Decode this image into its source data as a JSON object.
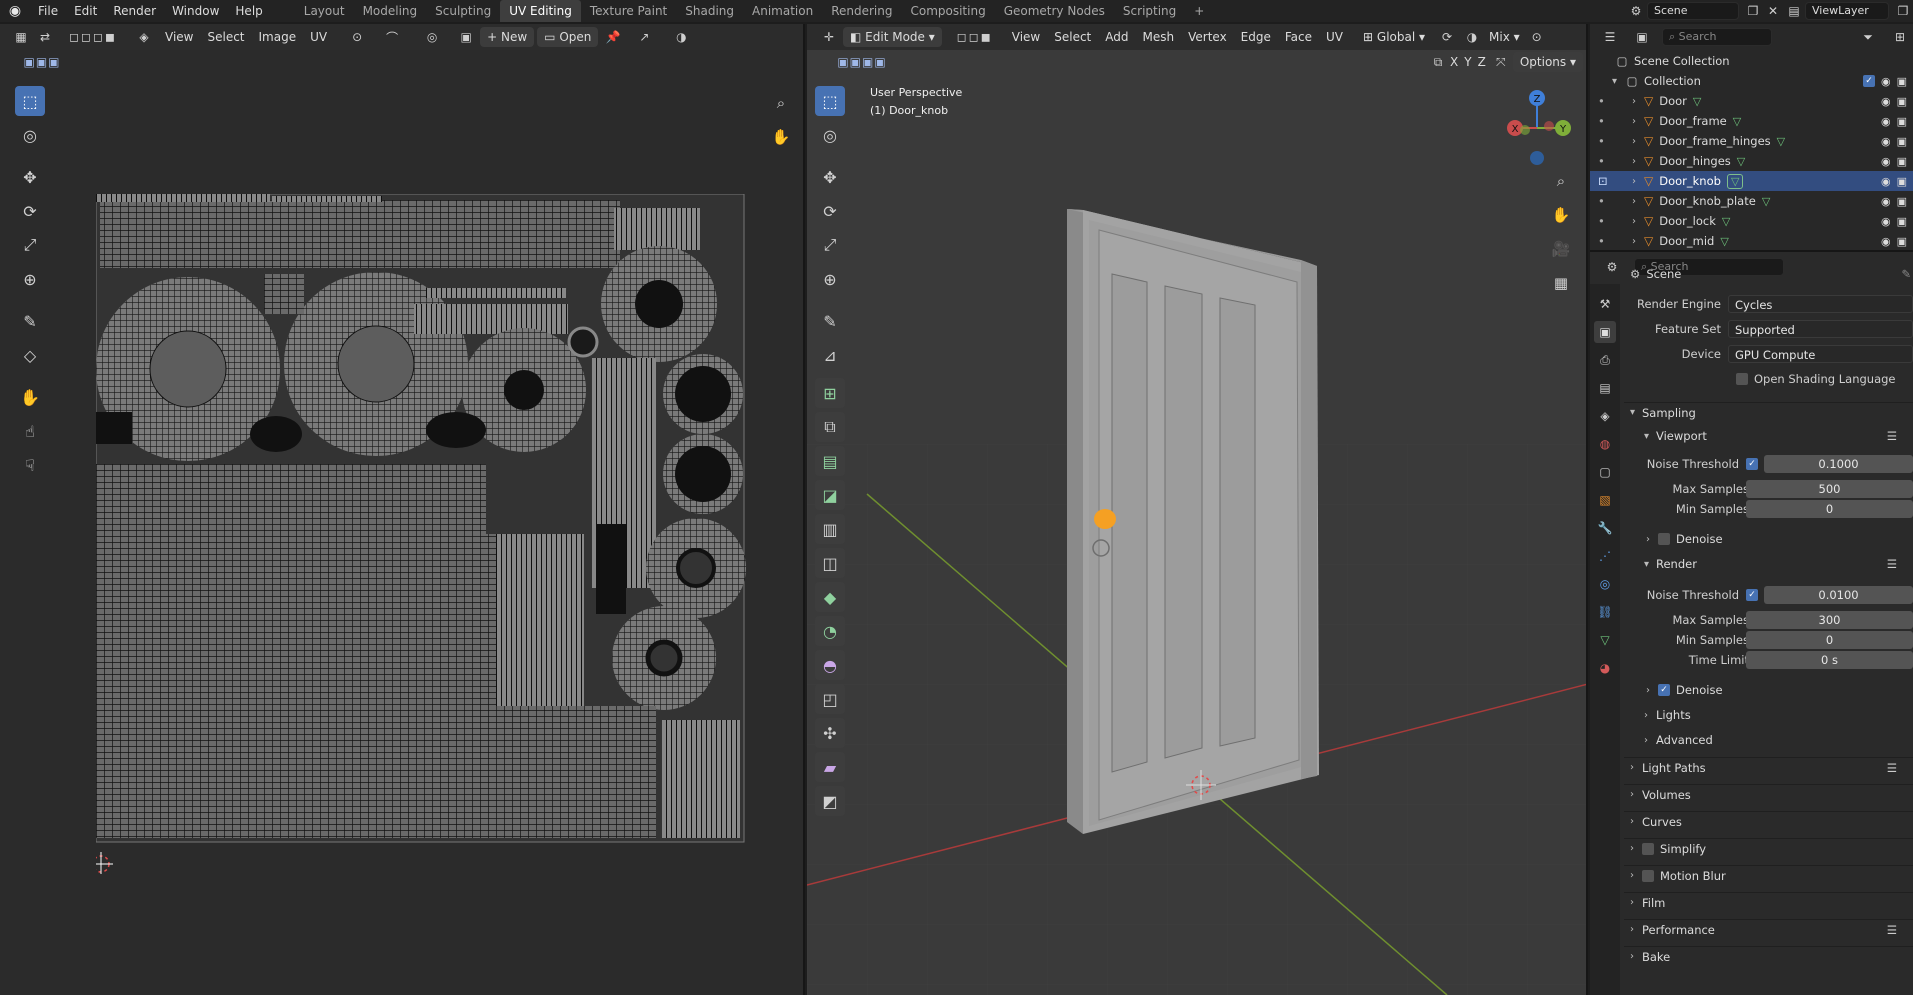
{
  "app": {
    "logo": "blender-logo-icon"
  },
  "menu": [
    "File",
    "Edit",
    "Render",
    "Window",
    "Help"
  ],
  "workspaces": [
    "Layout",
    "Modeling",
    "Sculpting",
    "UV Editing",
    "Texture Paint",
    "Shading",
    "Animation",
    "Rendering",
    "Compositing",
    "Geometry Nodes",
    "Scripting"
  ],
  "workspace_add": "+",
  "top_right": {
    "scene_label": "Scene",
    "viewlayer_label": "ViewLayer"
  },
  "uv_editor": {
    "menus": [
      "View",
      "Select",
      "Image",
      "UV"
    ],
    "new_label": "New",
    "open_label": "Open"
  },
  "viewport": {
    "mode_label": "Edit Mode",
    "menus": [
      "View",
      "Select",
      "Add",
      "Mesh",
      "Vertex",
      "Edge",
      "Face",
      "UV"
    ],
    "transform_orientation": "Global",
    "shading_mix": "Mix",
    "axis_x": "X",
    "axis_y": "Y",
    "axis_z": "Z",
    "options_label": "Options",
    "overlay_title": "User Perspective",
    "overlay_object": "(1) Door_knob",
    "gizmo": {
      "x": "X",
      "y": "Y",
      "z": "Z"
    }
  },
  "outliner": {
    "search_placeholder": "Search",
    "scene_collection": "Scene Collection",
    "collection": "Collection",
    "objects": [
      {
        "name": "Door",
        "selected": false
      },
      {
        "name": "Door_frame",
        "selected": false
      },
      {
        "name": "Door_frame_hinges",
        "selected": false
      },
      {
        "name": "Door_hinges",
        "selected": false
      },
      {
        "name": "Door_knob",
        "selected": true
      },
      {
        "name": "Door_knob_plate",
        "selected": false
      },
      {
        "name": "Door_lock",
        "selected": false
      },
      {
        "name": "Door_mid",
        "selected": false
      }
    ]
  },
  "properties": {
    "search_placeholder": "Search",
    "context": "Scene",
    "render_engine_label": "Render Engine",
    "render_engine": "Cycles",
    "feature_set_label": "Feature Set",
    "feature_set": "Supported",
    "device_label": "Device",
    "device": "GPU Compute",
    "osl_label": "Open Shading Language",
    "sampling": "Sampling",
    "viewport": {
      "title": "Viewport",
      "noise_threshold_label": "Noise Threshold",
      "noise_threshold": "0.1000",
      "max_samples_label": "Max Samples",
      "max_samples": "500",
      "min_samples_label": "Min Samples",
      "min_samples": "0",
      "denoise_label": "Denoise"
    },
    "render": {
      "title": "Render",
      "noise_threshold_label": "Noise Threshold",
      "noise_threshold": "0.0100",
      "max_samples_label": "Max Samples",
      "max_samples": "300",
      "min_samples_label": "Min Samples",
      "min_samples": "0",
      "time_limit_label": "Time Limit",
      "time_limit": "0 s",
      "denoise_label": "Denoise"
    },
    "lights": "Lights",
    "advanced": "Advanced",
    "light_paths": "Light Paths",
    "volumes": "Volumes",
    "curves": "Curves",
    "simplify": "Simplify",
    "motion_blur": "Motion Blur",
    "film": "Film",
    "performance": "Performance",
    "bake": "Bake"
  },
  "colors": {
    "accent": "#4772b3",
    "selected_object": "#f5a023",
    "mesh_icon": "#6dc07a",
    "object_icon": "#e18a2c"
  }
}
